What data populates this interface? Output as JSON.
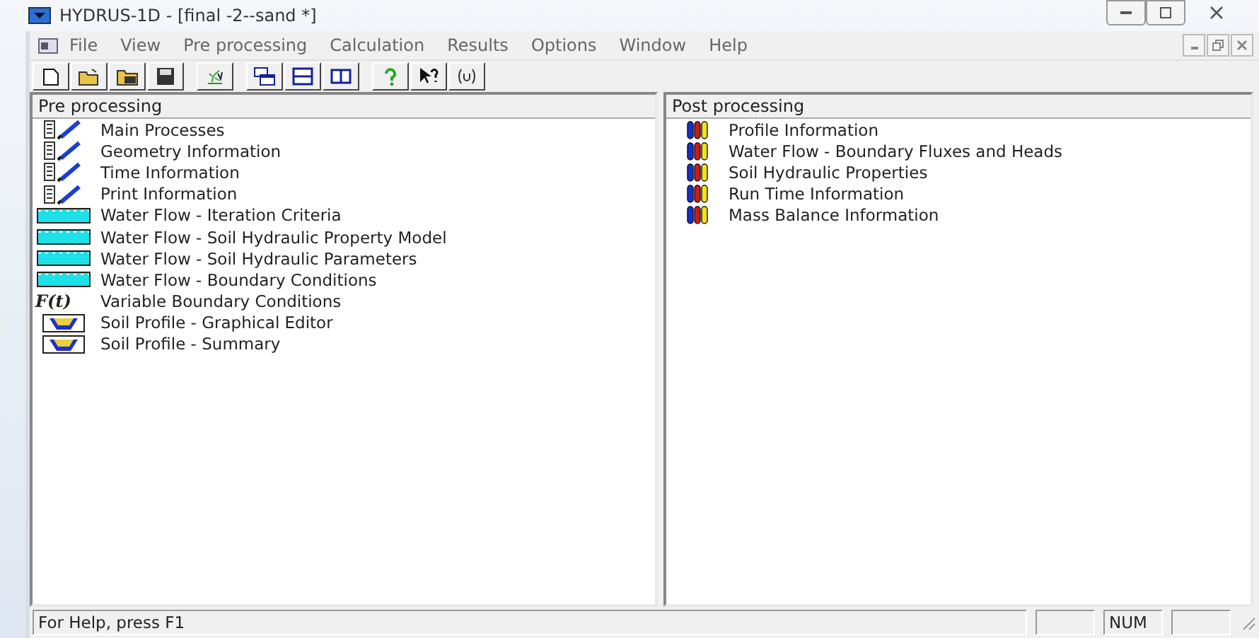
{
  "window": {
    "title": "HYDRUS-1D - [final -2--sand *]"
  },
  "menu": [
    "File",
    "View",
    "Pre processing",
    "Calculation",
    "Results",
    "Options",
    "Window",
    "Help"
  ],
  "toolbar": [
    {
      "kind": "new"
    },
    {
      "kind": "open"
    },
    {
      "kind": "folder"
    },
    {
      "kind": "save"
    },
    {
      "kind": "run"
    },
    {
      "kind": "cascade"
    },
    {
      "kind": "tile-h"
    },
    {
      "kind": "tile-v"
    },
    {
      "kind": "help"
    },
    {
      "kind": "context-help"
    },
    {
      "kind": "about"
    }
  ],
  "pre_processing": {
    "title": "Pre processing",
    "items": [
      {
        "label": "Main Processes",
        "kind": "pencil"
      },
      {
        "label": "Geometry Information",
        "kind": "pencil"
      },
      {
        "label": "Time Information",
        "kind": "pencil"
      },
      {
        "label": "Print Information",
        "kind": "pencil"
      },
      {
        "label": "Water Flow - Iteration Criteria",
        "kind": "water"
      },
      {
        "label": "Water Flow - Soil Hydraulic Property Model",
        "kind": "water"
      },
      {
        "label": "Water Flow - Soil Hydraulic Parameters",
        "kind": "water"
      },
      {
        "label": "Water Flow - Boundary Conditions",
        "kind": "water"
      },
      {
        "label": "Variable Boundary Conditions",
        "kind": "function",
        "icon_text": "F(t)"
      },
      {
        "label": "Soil Profile - Graphical Editor",
        "kind": "profile"
      },
      {
        "label": "Soil Profile - Summary",
        "kind": "profile"
      }
    ]
  },
  "post_processing": {
    "title": "Post processing",
    "items": [
      {
        "label": "Profile Information"
      },
      {
        "label": "Water Flow - Boundary Fluxes and Heads"
      },
      {
        "label": "Soil Hydraulic Properties"
      },
      {
        "label": "Run Time Information"
      },
      {
        "label": "Mass Balance Information"
      }
    ]
  },
  "status_bar": {
    "message": "For Help, press F1",
    "indicators": [
      "NUM"
    ]
  }
}
